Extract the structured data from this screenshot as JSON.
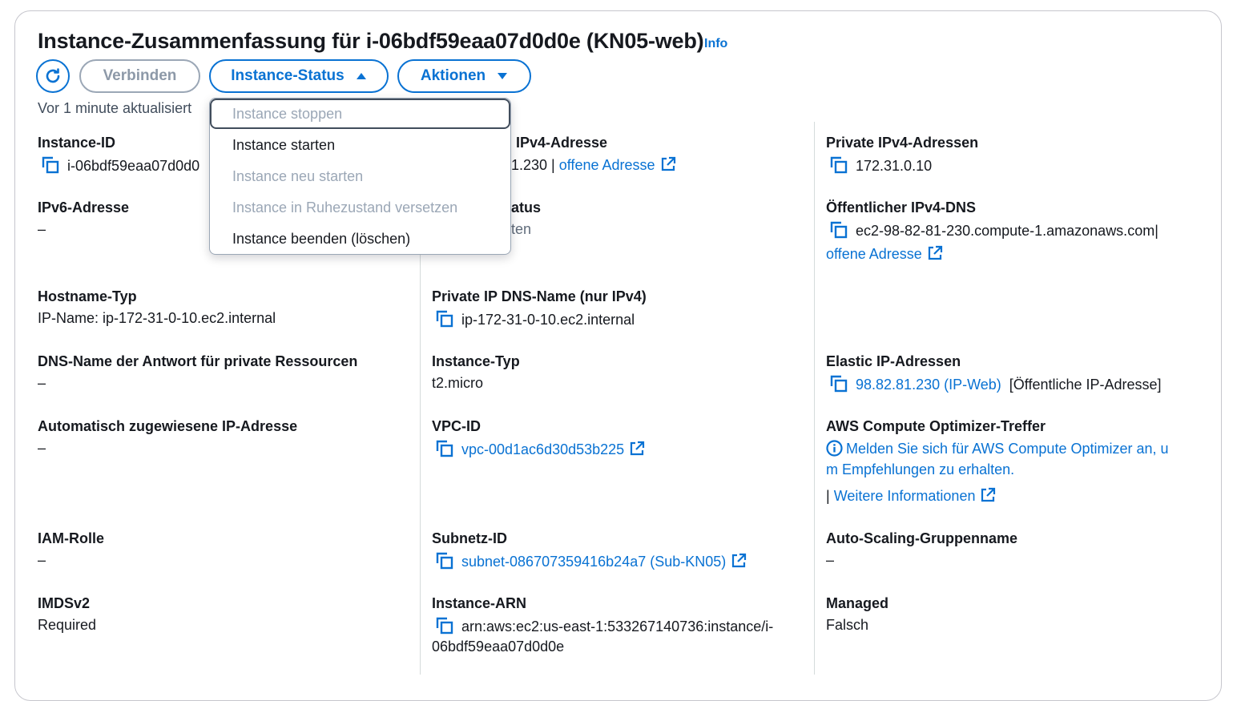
{
  "header": {
    "title": "Instance-Zusammenfassung für i-06bdf59eaa07d0d0e (KN05-web)",
    "info": "Info"
  },
  "toolbar": {
    "connect": "Verbinden",
    "instance_state": "Instance-Status",
    "actions": "Aktionen",
    "updated": "Vor 1 minute aktualisiert"
  },
  "dropdown": {
    "items": [
      {
        "label": "Instance stoppen",
        "enabled": false
      },
      {
        "label": "Instance starten",
        "enabled": true
      },
      {
        "label": "Instance neu starten",
        "enabled": false
      },
      {
        "label": "Instance in Ruhezustand versetzen",
        "enabled": false
      },
      {
        "label": "Instance beenden (löschen)",
        "enabled": true
      }
    ]
  },
  "col1": {
    "instance_id_label": "Instance-ID",
    "instance_id_value": "i-06bdf59eaa07d0d0",
    "ipv6_label": "IPv6-Adresse",
    "ipv6_value": "–",
    "hostname_type_label": "Hostname-Typ",
    "hostname_type_value": "IP-Name: ip-172-31-0-10.ec2.internal",
    "dns_answer_label": "DNS-Name der Antwort für private Ressourcen",
    "dns_answer_value": "–",
    "auto_ip_label": "Automatisch zugewiesene IP-Adresse",
    "auto_ip_value": "–",
    "iam_label": "IAM-Rolle",
    "iam_value": "–",
    "imds_label": "IMDSv2",
    "imds_value": "Required"
  },
  "col2": {
    "public_ipv4_label": "IPv4-Adresse",
    "public_ipv4_value": "1.230 |",
    "public_ipv4_link": "offene Adresse",
    "state_label": "atus",
    "state_value": "ten",
    "private_dns_label": "Private IP DNS-Name (nur IPv4)",
    "private_dns_value": "ip-172-31-0-10.ec2.internal",
    "instance_type_label": "Instance-Typ",
    "instance_type_value": "t2.micro",
    "vpc_label": "VPC-ID",
    "vpc_value": "vpc-00d1ac6d30d53b225",
    "subnet_label": "Subnetz-ID",
    "subnet_value": "subnet-086707359416b24a7 (Sub-KN05)",
    "arn_label": "Instance-ARN",
    "arn_value_line1": "arn:aws:ec2:us-east-1:533267140736:instance/i-",
    "arn_value_line2": "06bdf59eaa07d0d0e"
  },
  "col3": {
    "private_ipv4_label": "Private IPv4-Adressen",
    "private_ipv4_value": "172.31.0.10",
    "public_dns_label": "Öffentlicher IPv4-DNS",
    "public_dns_value": "ec2-98-82-81-230.compute-1.amazonaws.com",
    "public_dns_sep": "|",
    "public_dns_link": "offene Adresse",
    "elastic_label": "Elastic IP-Adressen",
    "elastic_value": "98.82.81.230 (IP-Web)",
    "elastic_suffix": "[Öffentliche IP-Adresse]",
    "optimizer_label": "AWS Compute Optimizer-Treffer",
    "optimizer_line1": "Melden Sie sich für AWS Compute Optimizer an, u",
    "optimizer_line2": "m Empfehlungen zu erhalten.",
    "optimizer_more_sep": "|",
    "optimizer_more": "Weitere Informationen",
    "asg_label": "Auto-Scaling-Gruppenname",
    "asg_value": "–",
    "managed_label": "Managed",
    "managed_value": "Falsch"
  },
  "colors": {
    "link": "#0972d3",
    "text": "#16191f",
    "disabled": "#9ba7b6"
  }
}
